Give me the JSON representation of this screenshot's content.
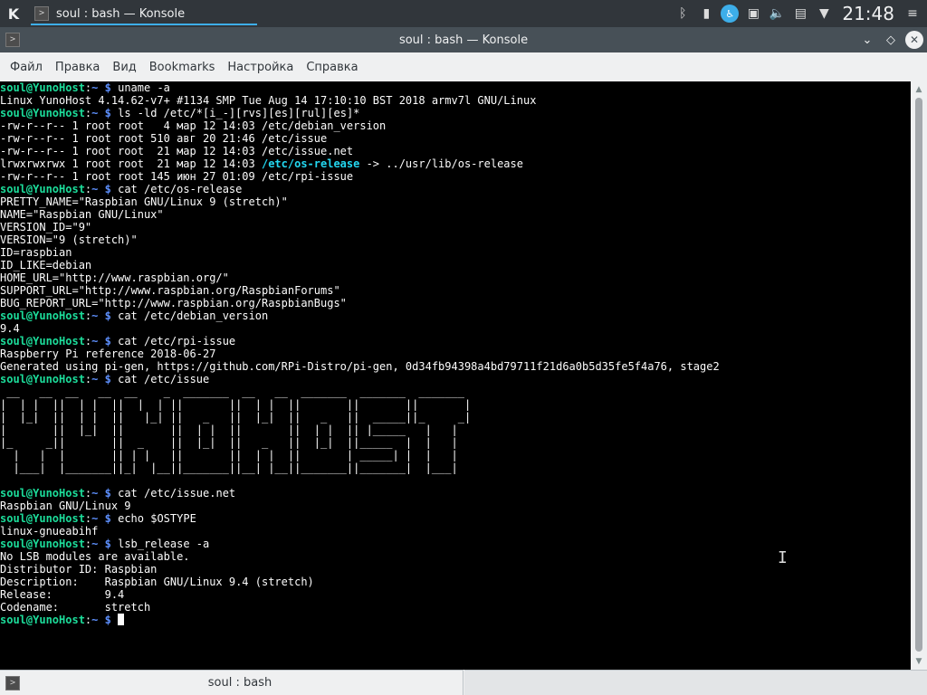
{
  "panel": {
    "launcher_icon": "kde-launcher-icon",
    "task_label": "soul : bash — Konsole",
    "clock": "21:48",
    "tray_icons": [
      "bluetooth-icon",
      "battery-icon",
      "accessibility-icon",
      "network-icon",
      "volume-icon",
      "clipboard-icon",
      "expand-arrow-icon",
      "menu-icon"
    ]
  },
  "window": {
    "title": "soul : bash — Konsole"
  },
  "menu": {
    "items": [
      "Файл",
      "Правка",
      "Вид",
      "Bookmarks",
      "Настройка",
      "Справка"
    ]
  },
  "prompt": {
    "user": "soul@YunoHost",
    "sep": ":",
    "path": "~",
    "sym": "$"
  },
  "terminal": {
    "lines": [
      {
        "t": "cmd",
        "v": "uname -a"
      },
      {
        "t": "out",
        "v": "Linux YunoHost 4.14.62-v7+ #1134 SMP Tue Aug 14 17:10:10 BST 2018 armv7l GNU/Linux"
      },
      {
        "t": "cmd",
        "v": "ls -ld /etc/*[i_-][rvs][es][rul][es]*"
      },
      {
        "t": "out",
        "v": "-rw-r--r-- 1 root root   4 мар 12 14:03 /etc/debian_version"
      },
      {
        "t": "out",
        "v": "-rw-r--r-- 1 root root 510 авг 20 21:46 /etc/issue"
      },
      {
        "t": "out",
        "v": "-rw-r--r-- 1 root root  21 мар 12 14:03 /etc/issue.net"
      },
      {
        "t": "lnk",
        "a": "lrwxrwxrwx 1 root root  21 мар 12 14:03 ",
        "b": "/etc/os-release",
        "c": " -> ../usr/lib/os-release"
      },
      {
        "t": "out",
        "v": "-rw-r--r-- 1 root root 145 июн 27 01:09 /etc/rpi-issue"
      },
      {
        "t": "cmd",
        "v": "cat /etc/os-release"
      },
      {
        "t": "out",
        "v": "PRETTY_NAME=\"Raspbian GNU/Linux 9 (stretch)\""
      },
      {
        "t": "out",
        "v": "NAME=\"Raspbian GNU/Linux\""
      },
      {
        "t": "out",
        "v": "VERSION_ID=\"9\""
      },
      {
        "t": "out",
        "v": "VERSION=\"9 (stretch)\""
      },
      {
        "t": "out",
        "v": "ID=raspbian"
      },
      {
        "t": "out",
        "v": "ID_LIKE=debian"
      },
      {
        "t": "out",
        "v": "HOME_URL=\"http://www.raspbian.org/\""
      },
      {
        "t": "out",
        "v": "SUPPORT_URL=\"http://www.raspbian.org/RaspbianForums\""
      },
      {
        "t": "out",
        "v": "BUG_REPORT_URL=\"http://www.raspbian.org/RaspbianBugs\""
      },
      {
        "t": "cmd",
        "v": "cat /etc/debian_version"
      },
      {
        "t": "out",
        "v": "9.4"
      },
      {
        "t": "cmd",
        "v": "cat /etc/rpi-issue"
      },
      {
        "t": "out",
        "v": "Raspberry Pi reference 2018-06-27"
      },
      {
        "t": "out",
        "v": "Generated using pi-gen, https://github.com/RPi-Distro/pi-gen, 0d34fb94398a4bd79711f21d6a0b5d35fe5f4a76, stage2"
      },
      {
        "t": "cmd",
        "v": "cat /etc/issue"
      },
      {
        "t": "out",
        "v": " __   __  __   __  __    _  _______  __   __  _______  _______  _______ "
      },
      {
        "t": "out",
        "v": "|  | |  ||  | |  ||  |  | ||       ||  | |  ||       ||       ||       |"
      },
      {
        "t": "out",
        "v": "|  |_|  ||  | |  ||   |_| ||   _   ||  |_|  ||   _   ||  _____||_     _|"
      },
      {
        "t": "out",
        "v": "|       ||  |_|  ||       ||  | |  ||       ||  | |  || |_____   |   |  "
      },
      {
        "t": "out",
        "v": "|_     _||       ||  _    ||  |_|  ||   _   ||  |_|  ||_____  |  |   |  "
      },
      {
        "t": "out",
        "v": "  |   |  |       || | |   ||       ||  | |  ||       | _____| |  |   |  "
      },
      {
        "t": "out",
        "v": "  |___|  |_______||_|  |__||_______||__| |__||_______||_______|  |___|  "
      },
      {
        "t": "out",
        "v": ""
      },
      {
        "t": "cmd",
        "v": "cat /etc/issue.net"
      },
      {
        "t": "out",
        "v": "Raspbian GNU/Linux 9"
      },
      {
        "t": "cmd",
        "v": "echo $OSTYPE"
      },
      {
        "t": "out",
        "v": "linux-gnueabihf"
      },
      {
        "t": "cmd",
        "v": "lsb_release -a"
      },
      {
        "t": "out",
        "v": "No LSB modules are available."
      },
      {
        "t": "out",
        "v": "Distributor ID:\tRaspbian"
      },
      {
        "t": "out",
        "v": "Description:\tRaspbian GNU/Linux 9.4 (stretch)"
      },
      {
        "t": "out",
        "v": "Release:\t9.4"
      },
      {
        "t": "out",
        "v": "Codename:\tstretch"
      },
      {
        "t": "cur",
        "v": ""
      }
    ]
  },
  "tabbar": {
    "tab_label": "soul : bash"
  }
}
